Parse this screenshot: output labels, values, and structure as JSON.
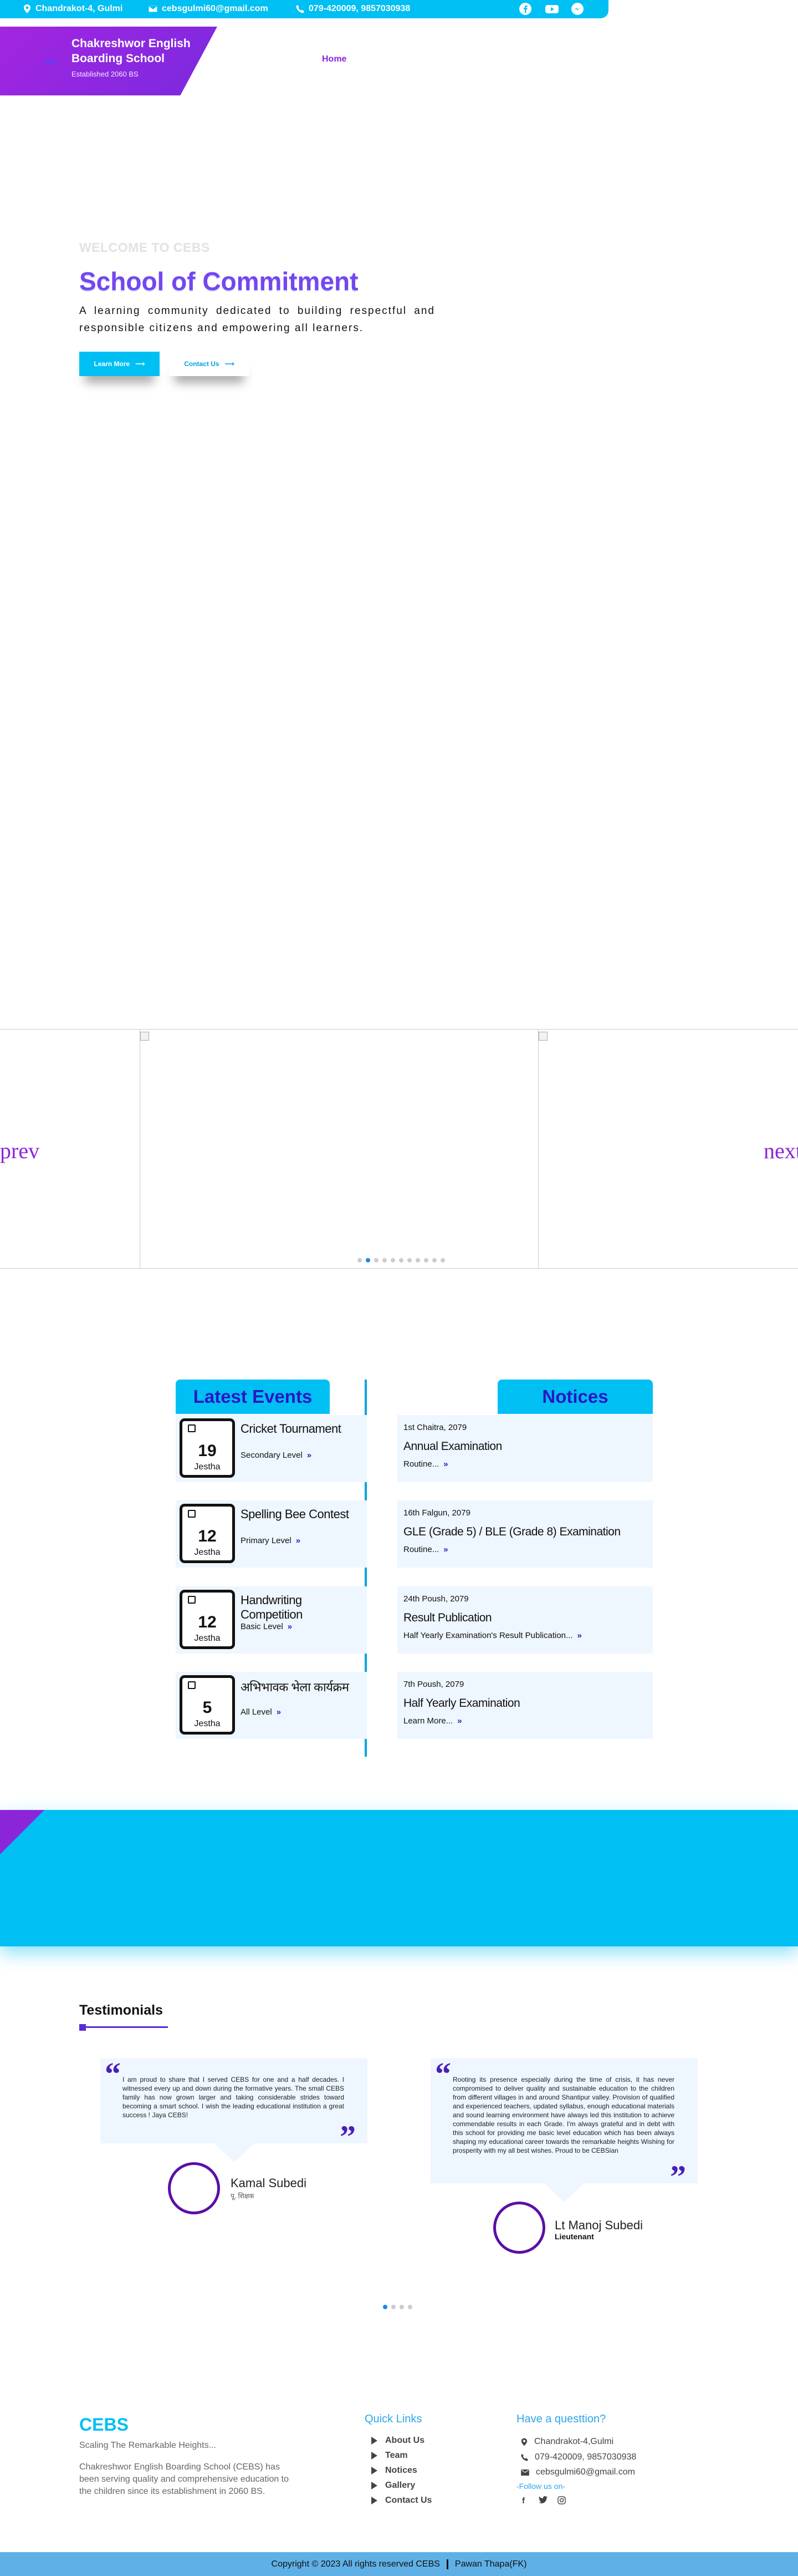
{
  "topbar": {
    "address": "Chandrakot-4, Gulmi",
    "email": "cebsgulmi60@gmail.com",
    "phone": "079-420009, 9857030938",
    "social": [
      "facebook-icon",
      "youtube-icon",
      "messenger-icon"
    ]
  },
  "brand": {
    "logo_alt": "logo",
    "name": "Chakreshwor English Boarding School",
    "established": "Established 2060 BS"
  },
  "nav": {
    "home": "Home"
  },
  "hero": {
    "welcome": "WELCOME TO CEBS",
    "title": "School of Commitment",
    "text": "A learning community dedicated to building respectful and responsible citizens and empowering all learners.",
    "learn_more": "Learn More",
    "contact_us": "Contact Us"
  },
  "carousel": {
    "prev": "prev",
    "next": "next",
    "dot_count": 11,
    "active_dot": 1
  },
  "events": {
    "heading": "Latest Events",
    "items": [
      {
        "day": "19",
        "month": "Jestha",
        "title": "Cricket Tournament",
        "level": "Secondary Level"
      },
      {
        "day": "12",
        "month": "Jestha",
        "title": "Spelling Bee Contest",
        "level": "Primary Level"
      },
      {
        "day": "12",
        "month": "Jestha",
        "title": "Handwriting Competition",
        "level": "Basic Level"
      },
      {
        "day": "5",
        "month": "Jestha",
        "title": "अभिभावक भेला कार्यक्रम",
        "level": "All Level"
      }
    ]
  },
  "notices": {
    "heading": "Notices",
    "items": [
      {
        "date": "1st Chaitra, 2079",
        "title": "Annual Examination",
        "more": "Routine..."
      },
      {
        "date": "16th Falgun, 2079",
        "title": "GLE (Grade 5) / BLE (Grade 8) Examination",
        "more": "Routine..."
      },
      {
        "date": "24th Poush, 2079",
        "title": "Result Publication",
        "more": "Half Yearly Examination's Result Publication..."
      },
      {
        "date": "7th Poush, 2079",
        "title": "Half Yearly Examination",
        "more": "Learn More..."
      }
    ]
  },
  "testimonials": {
    "heading": "Testimonials",
    "items": [
      {
        "text": "I am proud to share that I served CEBS for one and a half decades. I witnessed every up and down during the formative years. The small CEBS family has now grown larger and taking considerable strides toward becoming a smart school. I wish the leading educational institution a great success ! Jaya CEBS!",
        "name": "Kamal Subedi",
        "role": "पू. शिक्षक"
      },
      {
        "text": "Rooting its presence especially during the time of crisis, it has never compromised to deliver quality and sustainable education to the children from different villages in and around Shantipur valley. Provision of qualified and experienced teachers, updated syllabus, enough educational materials and sound learning environment have always led this institution to achieve commendable results in each Grade. I'm always grateful and in debt with this school for providing me basic level education which has been always shaping my educational career towards the remarkable heights Wishing for prosperity with my all best wishes. Proud to be CEBSian",
        "name": "Lt Manoj Subedi",
        "role": "Lieutenant"
      }
    ],
    "dot_count": 4,
    "active_dot": 0
  },
  "footer": {
    "brand": "CEBS",
    "tagline": "Scaling The Remarkable Heights...",
    "description": "Chakreshwor English Boarding School (CEBS) has been serving quality and comprehensive education to the children since its establishment in 2060 BS.",
    "quick_links_heading": "Quick Links",
    "quick_links": [
      "About Us",
      "Team",
      "Notices",
      "Gallery",
      "Contact Us"
    ],
    "contact_heading": "Have a questtion?",
    "address": "Chandrakot-4,Gulmi",
    "phone": "079-420009, 9857030938",
    "email": "cebsgulmi60@gmail.com",
    "follow": "-Follow us on-",
    "copyright": "Copyright © 2023 All rights reserved CEBS",
    "author": "Pawan Thapa(FK)"
  },
  "colors": {
    "primary": "#00bff3",
    "purple": "#8b26d8",
    "navy": "#2a17c4"
  }
}
